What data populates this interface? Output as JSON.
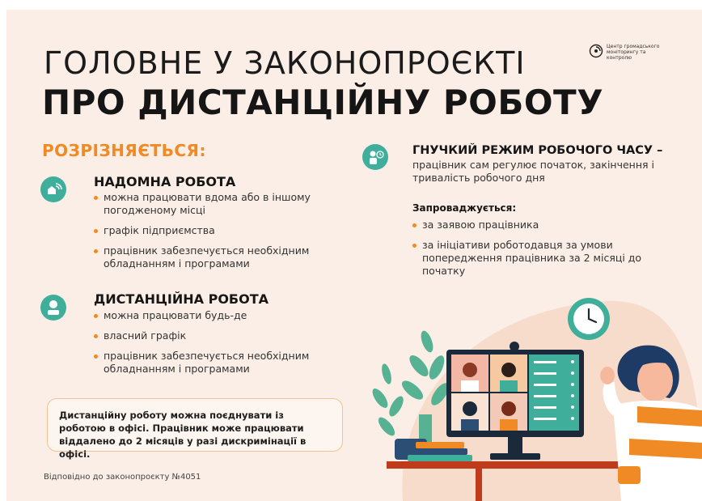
{
  "header": {
    "title_line1": "ГОЛОВНЕ У ЗАКОНОПРОЄКТІ",
    "title_line2": "ПРО ДИСТАНЦІЙНУ РОБОТУ",
    "logo_text": "Центр громадського моніторингу та контролю"
  },
  "left": {
    "heading": "РОЗРІЗНЯЄТЬСЯ:",
    "home": {
      "title": "НАДОМНА РОБОТА",
      "items": [
        "можна працювати вдома або в іншому погодженому місці",
        "графік підприємства",
        "працівник забезпечується необхідним обладнанням і програмами"
      ]
    },
    "remote": {
      "title": "ДИСТАНЦІЙНА РОБОТА",
      "items": [
        "можна працювати будь-де",
        "власний графік",
        "працівник забезпечується необхідним обладнанням і програмами"
      ]
    },
    "note": "Дистанційну роботу можна поєднувати із роботою в офісі. Працівник може працювати віддалено до 2 місяців у разі дискримінації в офісі."
  },
  "right": {
    "flex_title": "ГНУЧКИЙ РЕЖИМ РОБОЧОГО ЧАСУ –",
    "flex_desc": "працівник сам регулює початок, закінчення і тривалість робочого дня",
    "introduced_label": "Запроваджується:",
    "items": [
      "за заявою працівника",
      "за ініціативи роботодавця за умови попередження працівника за 2 місяці до початку"
    ]
  },
  "footer": "Відповідно до законопроєкту №4051",
  "icons": [
    "home-wifi-icon",
    "remote-worker-icon",
    "flex-schedule-icon",
    "clock-icon",
    "center-logo-icon"
  ],
  "colors": {
    "accent_orange": "#f08a24",
    "teal": "#3fae9a",
    "background": "#fbeee6"
  }
}
